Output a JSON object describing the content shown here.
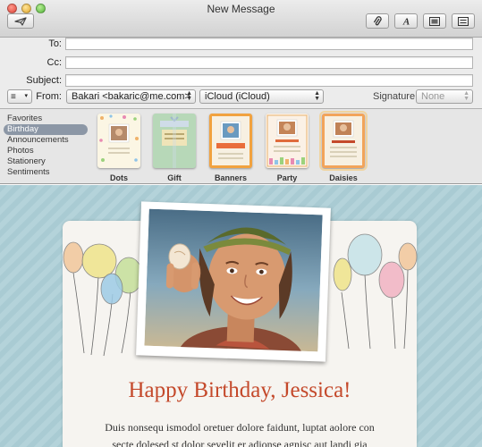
{
  "window": {
    "title": "New Message"
  },
  "toolbar": {
    "send_icon": "send-icon",
    "attach_icon": "paperclip-icon",
    "fonts_icon": "fonts-icon",
    "photo_browser_icon": "photo-browser-icon",
    "stationery_icon": "stationery-icon"
  },
  "fields": {
    "to_label": "To:",
    "cc_label": "Cc:",
    "subject_label": "Subject:",
    "to_value": "",
    "cc_value": "",
    "subject_value": "",
    "from_label": "From:",
    "from_value": "Bakari <bakaric@me.com>",
    "account_value": "iCloud (iCloud)",
    "signature_label": "Signature:",
    "signature_value": "None"
  },
  "stationery": {
    "categories": [
      "Favorites",
      "Birthday",
      "Announcements",
      "Photos",
      "Stationery",
      "Sentiments"
    ],
    "selected_category": "Birthday",
    "templates": [
      "Dots",
      "Gift",
      "Banners",
      "Party",
      "Daisies"
    ],
    "selected_template": "Daisies"
  },
  "message": {
    "headline": "Happy Birthday, Jessica!",
    "body_line1": "Duis nonsequ ismodol oretuer dolore faidunt, luptat aolore con",
    "body_line2": "secte dolesed st dolor sevelit er adionse agnisc aut landi gia"
  },
  "colors": {
    "headline": "#c4492b",
    "background_pattern": "#a9cbd3",
    "selected_category": "#8c97a6"
  }
}
